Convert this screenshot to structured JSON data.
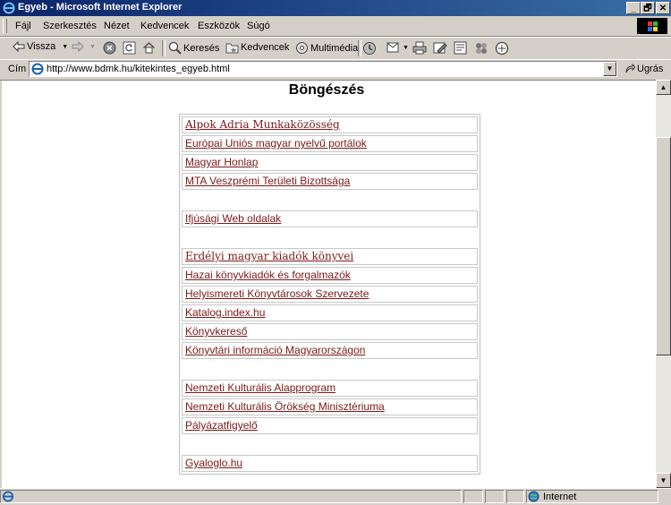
{
  "window": {
    "title": "Egyeb - Microsoft Internet Explorer"
  },
  "window_controls": {
    "minimize": "_",
    "restore": "🗗",
    "close": "✕"
  },
  "menu": [
    "Fájl",
    "Szerkesztés",
    "Nézet",
    "Kedvencek",
    "Eszközök",
    "Súgó"
  ],
  "toolbar": {
    "back": "Vissza",
    "search": "Keresés",
    "favorites": "Kedvencek",
    "media": "Multimédia"
  },
  "address": {
    "label": "Cím",
    "url": "http://www.bdmk.hu/kitekintes_egyeb.html",
    "go": "Ugrás"
  },
  "page": {
    "heading": "Böngészés",
    "links": [
      "Alpok Adria Munkaközösség",
      "Európai Uniós magyar nyelvű portálok",
      "Magyar Honlap",
      "MTA Veszprémi Területi Bizottsága",
      "",
      "Ifjúsági Web oldalak",
      "",
      "Erdélyi magyar kiadók könyvei",
      "Hazai könyvkiadók és forgalmazók",
      "Helyismereti Könyvtárosok Szervezete",
      "Katalog.index.hu",
      "Könyvkereső",
      "Könyvtári információ Magyarországon",
      "",
      "Nemzeti Kulturális Alapprogram",
      "Nemzeti Kulturális Örökség Minisztériuma",
      "Pályázatfigyelő",
      "",
      "Gyaloglo.hu"
    ]
  },
  "status": {
    "zone": "Internet"
  },
  "colors": {
    "link": "#7b1818",
    "titlebar": "#0a246a"
  }
}
